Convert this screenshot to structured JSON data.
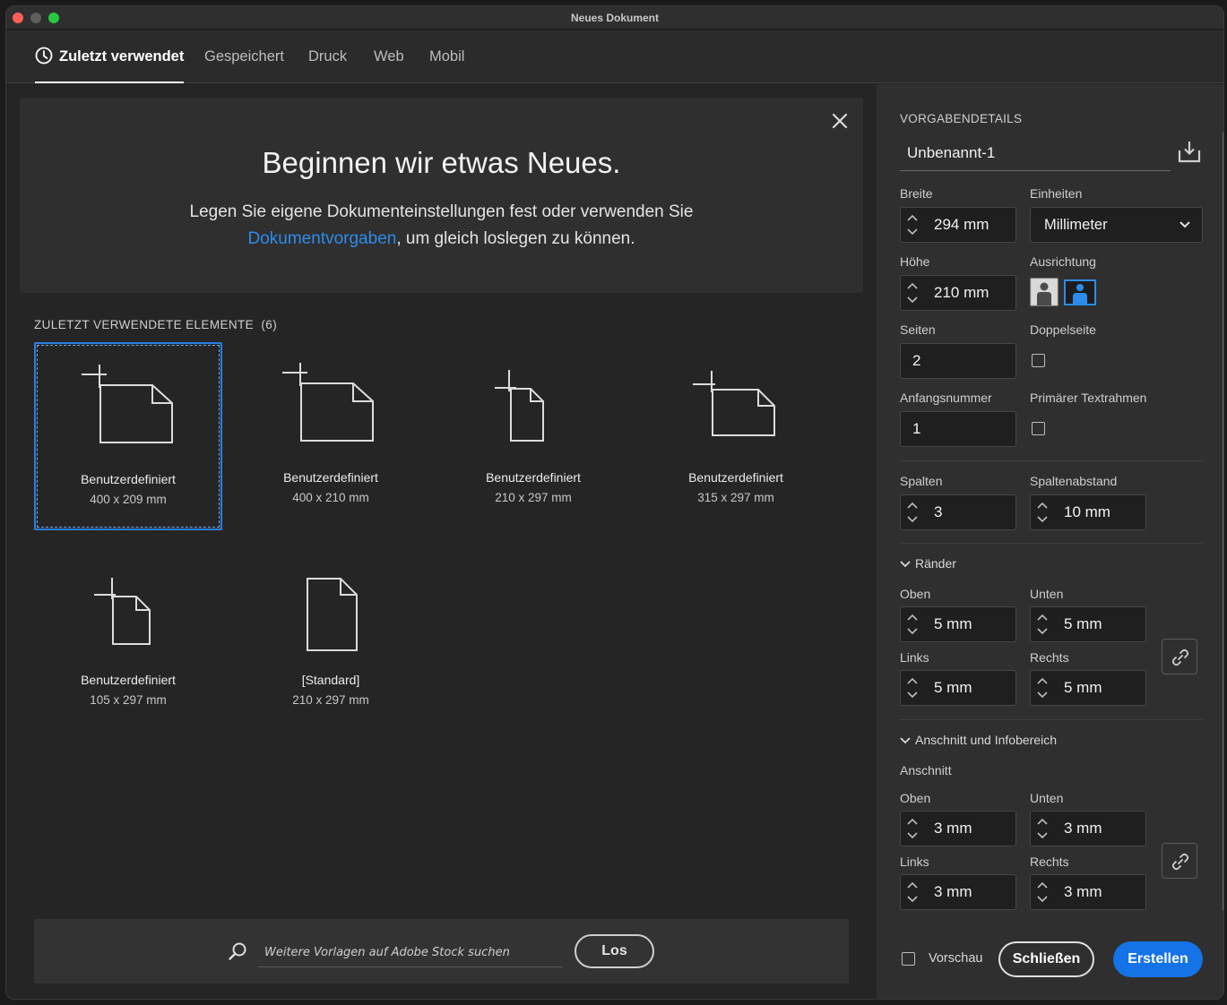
{
  "window": {
    "title": "Neues Dokument"
  },
  "tabs": [
    {
      "label": "Zuletzt verwendet",
      "icon": "clock-icon",
      "active": true
    },
    {
      "label": "Gespeichert"
    },
    {
      "label": "Druck"
    },
    {
      "label": "Web"
    },
    {
      "label": "Mobil"
    }
  ],
  "hero": {
    "title": "Beginnen wir etwas Neues.",
    "text_line1": "Legen Sie eigene Dokumenteinstellungen fest oder verwenden Sie",
    "link": "Dokumentvorgaben",
    "text_line2_rest": ", um gleich loslegen zu können."
  },
  "recent": {
    "heading": "ZULETZT VERWENDETE ELEMENTE",
    "count": "(6)",
    "items": [
      {
        "name": "Benutzerdefiniert",
        "size": "400 x 209 mm",
        "icon": "landscape-custom-doc-icon",
        "selected": true
      },
      {
        "name": "Benutzerdefiniert",
        "size": "400 x 210 mm",
        "icon": "landscape-custom-doc-icon"
      },
      {
        "name": "Benutzerdefiniert",
        "size": "210 x 297 mm",
        "icon": "portrait-custom-doc-icon"
      },
      {
        "name": "Benutzerdefiniert",
        "size": "315 x 297 mm",
        "icon": "landscape-custom-doc-icon"
      },
      {
        "name": "Benutzerdefiniert",
        "size": "105 x 297 mm",
        "icon": "portrait-custom-doc-icon"
      },
      {
        "name": "[Standard]",
        "size": "210 x 297 mm",
        "icon": "portrait-doc-icon"
      }
    ]
  },
  "stock": {
    "placeholder": "Weitere Vorlagen auf Adobe Stock suchen",
    "go_label": "Los"
  },
  "details": {
    "heading": "VORGABENDETAILS",
    "doc_name": "Unbenannt-1",
    "width_label": "Breite",
    "width_value": "294 mm",
    "units_label": "Einheiten",
    "units_value": "Millimeter",
    "height_label": "Höhe",
    "height_value": "210 mm",
    "orientation_label": "Ausrichtung",
    "orientation_selected": "landscape",
    "pages_label": "Seiten",
    "pages_value": "2",
    "facing_label": "Doppelseite",
    "facing_checked": false,
    "start_label": "Anfangsnummer",
    "start_value": "1",
    "primary_frame_label": "Primärer Textrahmen",
    "primary_frame_checked": false,
    "columns_label": "Spalten",
    "columns_value": "3",
    "gutter_label": "Spaltenabstand",
    "gutter_value": "10 mm"
  },
  "margins": {
    "title": "Ränder",
    "top_label": "Oben",
    "top_value": "5 mm",
    "bottom_label": "Unten",
    "bottom_value": "5 mm",
    "left_label": "Links",
    "left_value": "5 mm",
    "right_label": "Rechts",
    "right_value": "5 mm"
  },
  "bleed": {
    "title": "Anschnitt und Infobereich",
    "subtitle": "Anschnitt",
    "top_label": "Oben",
    "top_value": "3 mm",
    "bottom_label": "Unten",
    "bottom_value": "3 mm",
    "left_label": "Links",
    "left_value": "3 mm",
    "right_label": "Rechts",
    "right_value": "3 mm"
  },
  "footer": {
    "preview_label": "Vorschau",
    "preview_checked": false,
    "close_label": "Schließen",
    "create_label": "Erstellen"
  },
  "colors": {
    "accent": "#1473e6",
    "link": "#2d8ceb",
    "selection": "#2a7fe0",
    "panel": "#2f2f2f",
    "background": "#252525"
  }
}
